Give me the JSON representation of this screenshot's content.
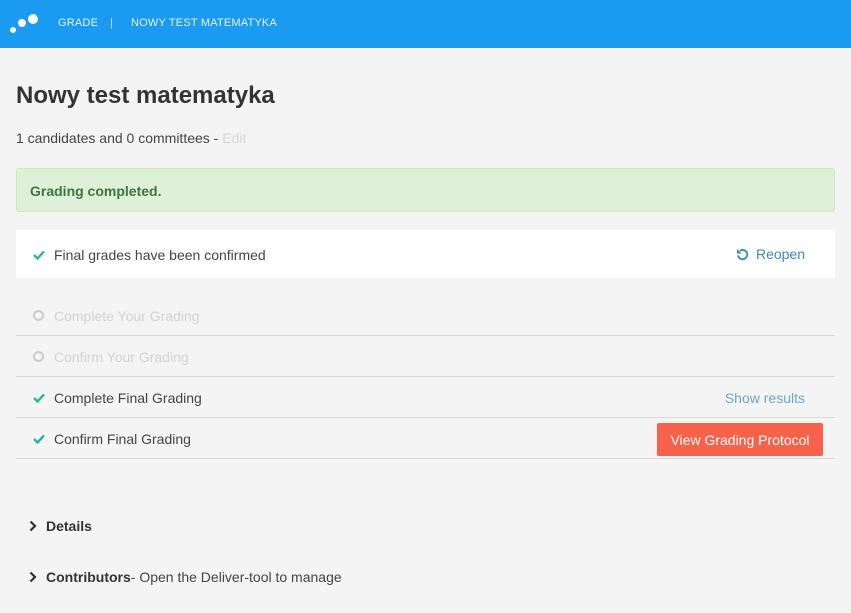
{
  "header": {
    "crumbs": [
      "GRADE",
      "|",
      "NOWY TEST MATEMATYKA"
    ]
  },
  "page": {
    "title": "Nowy test matematyka",
    "subtitle": "1 candidates and 0 committees - ",
    "edit_label": "Edit"
  },
  "alert": {
    "text": "Grading completed."
  },
  "confirmed": {
    "text": "Final grades have been confirmed",
    "reopen_label": "Reopen"
  },
  "steps": [
    {
      "label": "Complete Your Grading",
      "state": "disabled"
    },
    {
      "label": "Confirm Your Grading",
      "state": "disabled"
    },
    {
      "label": "Complete Final Grading",
      "state": "done",
      "action": "Show results"
    },
    {
      "label": "Confirm Final Grading",
      "state": "done",
      "action": "View Grading Protocol"
    }
  ],
  "sections": {
    "details": {
      "label": "Details"
    },
    "contributors": {
      "label": "Contributors",
      "desc": " - Open the Deliver-tool to manage"
    }
  },
  "colors": {
    "topbar": "#1a9af0",
    "success_check": "#2bb59a",
    "primary_button": "#f8614a",
    "link": "#3d88b8"
  }
}
